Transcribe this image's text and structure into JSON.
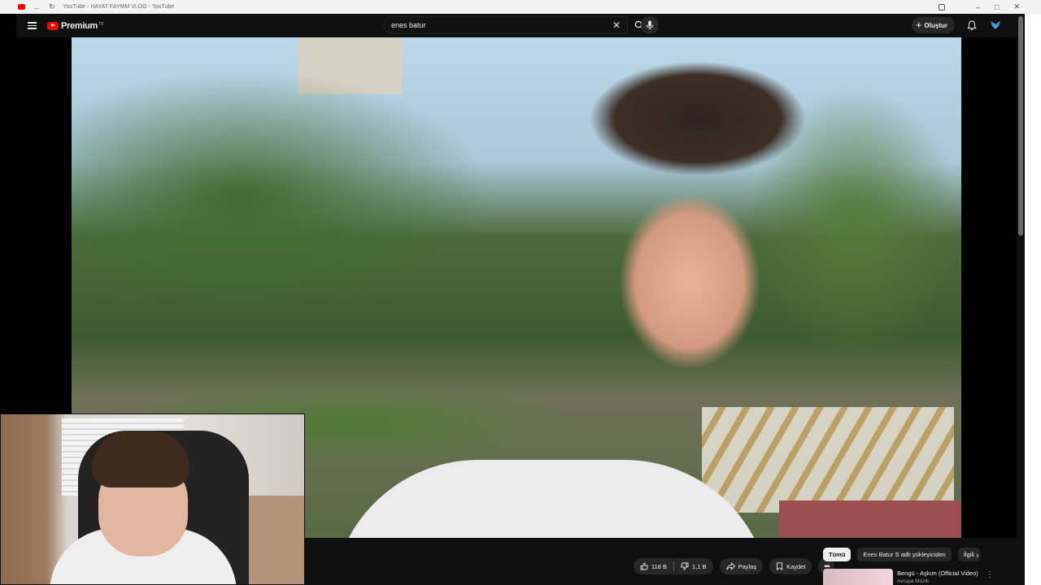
{
  "browser": {
    "tab_title": "YouTube - HAYAT FAYMM VLOG - YouTube",
    "icons": [
      "back-icon",
      "reload-icon",
      "extensions-icon",
      "minimize-icon",
      "maximize-icon",
      "close-icon"
    ]
  },
  "masthead": {
    "brand": "Premium",
    "region": "TR",
    "search_value": "enes batur",
    "create_label": "Oluştur"
  },
  "actions": {
    "like_count": "118 B",
    "dislike_count": "1,1 B",
    "share_label": "Paylaş",
    "save_label": "Kaydet"
  },
  "chips": [
    "Tümü",
    "Enes Batur S adlı yükleyiciden",
    "İlgili"
  ],
  "recommendation": {
    "title": "Bengü - Aşkım (Official Video)",
    "channel": "Avrupa Müzik"
  },
  "colors": {
    "youtube_red": "#ff0000",
    "background": "#0f0f0f",
    "chip_bg": "#272727"
  }
}
